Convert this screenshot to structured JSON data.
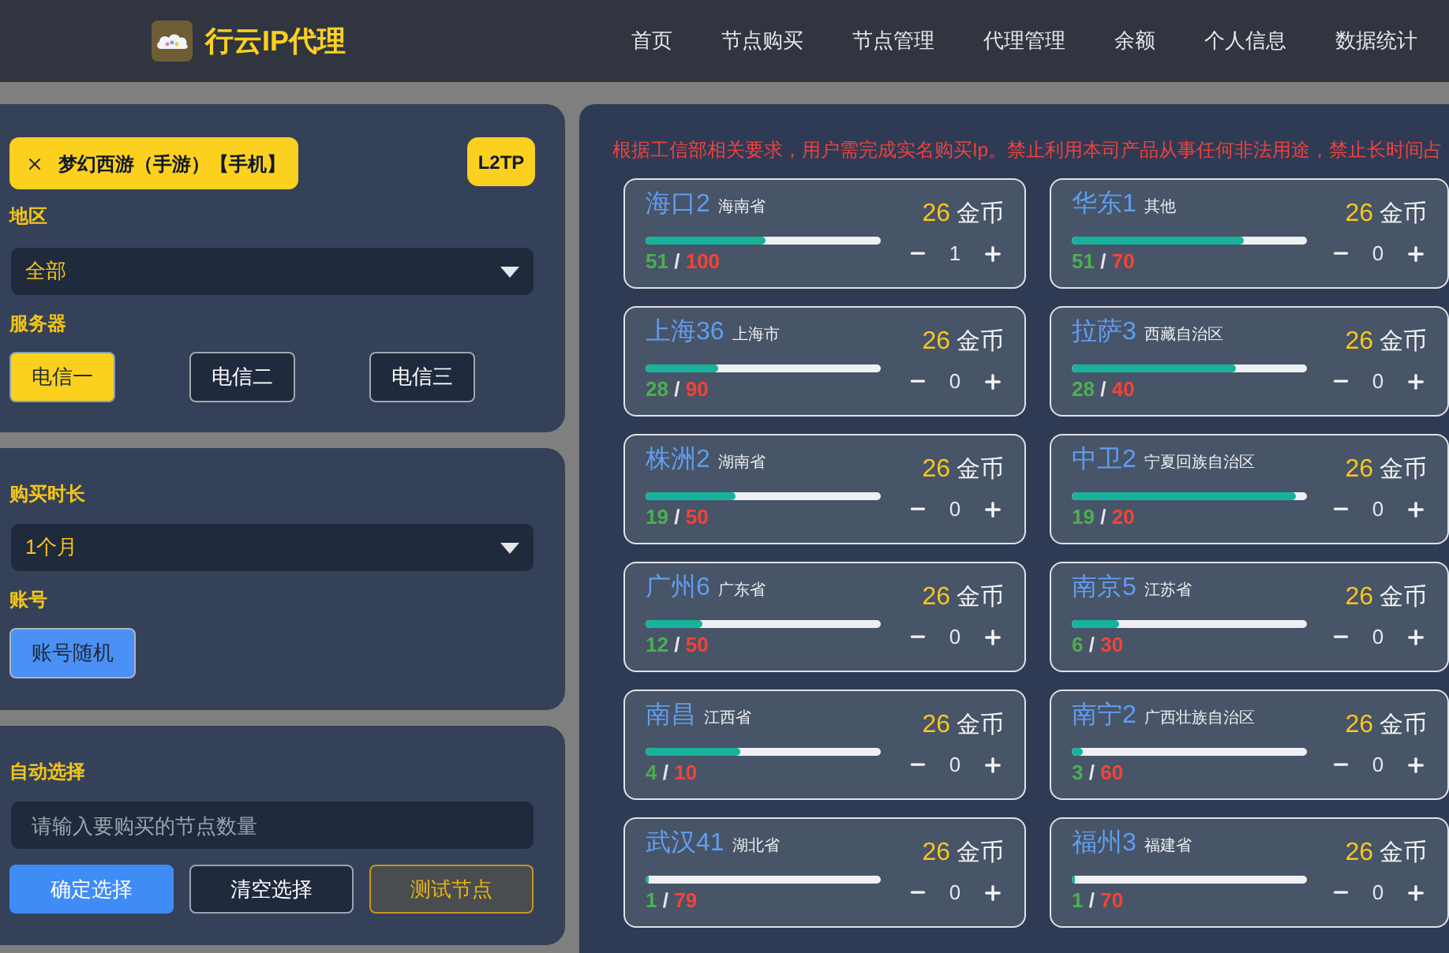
{
  "header": {
    "title": "行云IP代理",
    "nav": [
      {
        "label": "首页"
      },
      {
        "label": "节点购买"
      },
      {
        "label": "节点管理"
      },
      {
        "label": "代理管理"
      },
      {
        "label": "余额"
      },
      {
        "label": "个人信息"
      },
      {
        "label": "数据统计"
      }
    ]
  },
  "selection": {
    "tag": "梦幻西游（手游）【手机】",
    "protocol": "L2TP"
  },
  "region": {
    "label": "地区",
    "value": "全部"
  },
  "server": {
    "label": "服务器",
    "options": [
      {
        "label": "电信一",
        "selected": true
      },
      {
        "label": "电信二",
        "selected": false
      },
      {
        "label": "电信三",
        "selected": false
      }
    ]
  },
  "duration": {
    "label": "购买时长",
    "value": "1个月"
  },
  "account": {
    "label": "账号",
    "button": "账号随机"
  },
  "auto_select": {
    "label": "自动选择",
    "input": {
      "placeholder": "请输入要购买的节点数量"
    },
    "buttons": [
      {
        "label": "确定选择",
        "kind": "primary"
      },
      {
        "label": "清空选择",
        "kind": "outline"
      },
      {
        "label": "测试节点",
        "kind": "warning"
      }
    ]
  },
  "notice": "根据工信部相关要求，用户需完成实名购买Ip。禁止利用本司产品从事任何非法用途，禁止长时间占",
  "nodes": [
    {
      "name": "海口2",
      "province": "海南省",
      "price": "26",
      "unit": "金币",
      "level": 0.51,
      "available": "51",
      "separator": "/",
      "total": "100",
      "quantity": "1"
    },
    {
      "name": "华东1",
      "province": "其他",
      "price": "26",
      "unit": "金币",
      "level": 0.73,
      "available": "51",
      "separator": "/",
      "total": "70",
      "quantity": "0"
    },
    {
      "name": "上海36",
      "province": "上海市",
      "price": "26",
      "unit": "金币",
      "level": 0.31,
      "available": "28",
      "separator": "/",
      "total": "90",
      "quantity": "0"
    },
    {
      "name": "拉萨3",
      "province": "西藏自治区",
      "price": "26",
      "unit": "金币",
      "level": 0.7,
      "available": "28",
      "separator": "/",
      "total": "40",
      "quantity": "0"
    },
    {
      "name": "株洲2",
      "province": "湖南省",
      "price": "26",
      "unit": "金币",
      "level": 0.38,
      "available": "19",
      "separator": "/",
      "total": "50",
      "quantity": "0"
    },
    {
      "name": "中卫2",
      "province": "宁夏回族自治区",
      "price": "26",
      "unit": "金币",
      "level": 0.95,
      "available": "19",
      "separator": "/",
      "total": "20",
      "quantity": "0"
    },
    {
      "name": "广州6",
      "province": "广东省",
      "price": "26",
      "unit": "金币",
      "level": 0.24,
      "available": "12",
      "separator": "/",
      "total": "50",
      "quantity": "0"
    },
    {
      "name": "南京5",
      "province": "江苏省",
      "price": "26",
      "unit": "金币",
      "level": 0.2,
      "available": "6",
      "separator": "/",
      "total": "30",
      "quantity": "0"
    },
    {
      "name": "南昌",
      "province": "江西省",
      "price": "26",
      "unit": "金币",
      "level": 0.4,
      "available": "4",
      "separator": "/",
      "total": "10",
      "quantity": "0"
    },
    {
      "name": "南宁2",
      "province": "广西壮族自治区",
      "price": "26",
      "unit": "金币",
      "level": 0.05,
      "available": "3",
      "separator": "/",
      "total": "60",
      "quantity": "0"
    },
    {
      "name": "武汉41",
      "province": "湖北省",
      "price": "26",
      "unit": "金币",
      "level": 0.013,
      "available": "1",
      "separator": "/",
      "total": "79",
      "quantity": "0"
    },
    {
      "name": "福州3",
      "province": "福建省",
      "price": "26",
      "unit": "金币",
      "level": 0.014,
      "available": "1",
      "separator": "/",
      "total": "70",
      "quantity": "0"
    }
  ]
}
